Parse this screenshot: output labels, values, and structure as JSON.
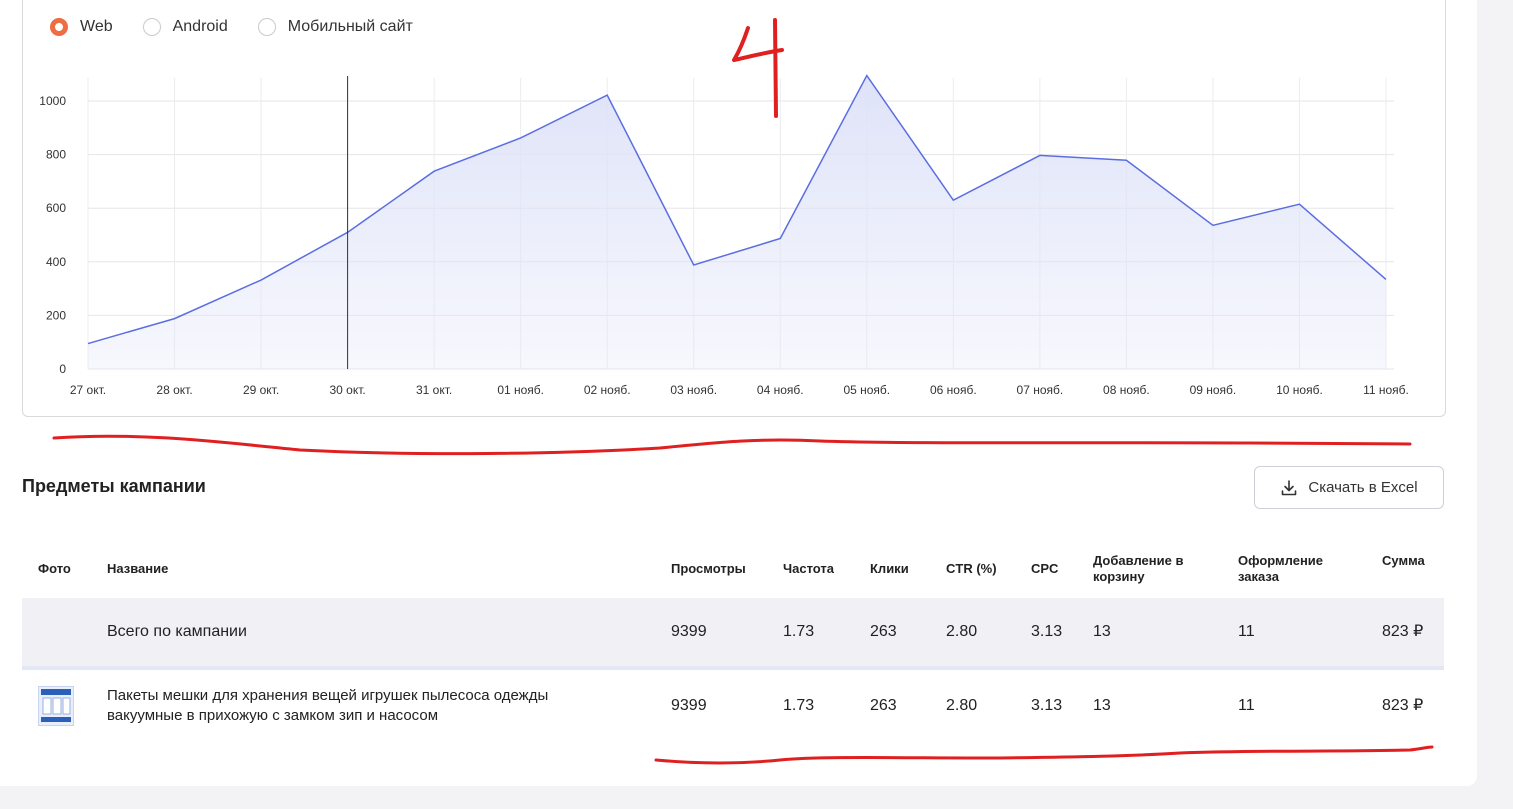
{
  "platform_filter": {
    "options": [
      {
        "label": "Web",
        "selected": true
      },
      {
        "label": "Android",
        "selected": false
      },
      {
        "label": "Мобильный сайт",
        "selected": false
      }
    ],
    "accent_color": "#ef6d43"
  },
  "chart_data": {
    "type": "area",
    "categories": [
      "27 окт.",
      "28 окт.",
      "29 окт.",
      "30 окт.",
      "31 окт.",
      "01 нояб.",
      "02 нояб.",
      "03 нояб.",
      "04 нояб.",
      "05 нояб.",
      "06 нояб.",
      "07 нояб.",
      "08 нояб.",
      "09 нояб.",
      "10 нояб.",
      "11 нояб."
    ],
    "values": [
      95,
      188,
      332,
      510,
      738,
      862,
      1022,
      388,
      487,
      1095,
      630,
      797,
      779,
      536,
      615,
      334
    ],
    "yticks": [
      0,
      200,
      400,
      600,
      800,
      1000
    ],
    "ylim": [
      0,
      1000
    ],
    "grid": true,
    "highlight_category": "30 окт.",
    "line_color": "#5b6ee1",
    "fill_color": "#dfe3f8"
  },
  "annotations": {
    "handwritten_mark": "4",
    "color": "#e02020"
  },
  "items_section": {
    "title": "Предметы кампании",
    "download_label": "Скачать в Excel",
    "download_icon": "download-icon"
  },
  "table": {
    "headers": {
      "photo": "Фото",
      "name": "Название",
      "views": "Просмотры",
      "frequency": "Частота",
      "clicks": "Клики",
      "ctr": "CTR (%)",
      "cpc": "CPC",
      "cart": "Добавление в корзину",
      "order": "Оформление заказа",
      "sum": "Сумма"
    },
    "total_row": {
      "name": "Всего по кампании",
      "views": "9399",
      "frequency": "1.73",
      "clicks": "263",
      "ctr": "2.80",
      "cpc": "3.13",
      "cart": "13",
      "order": "11",
      "sum": "823 ₽"
    },
    "rows": [
      {
        "name": "Пакеты мешки для хранения вещей игрушек пылесоса одежды вакуумные в прихожую с замком зип и насосом",
        "views": "9399",
        "frequency": "1.73",
        "clicks": "263",
        "ctr": "2.80",
        "cpc": "3.13",
        "cart": "13",
        "order": "11",
        "sum": "823 ₽"
      }
    ]
  }
}
